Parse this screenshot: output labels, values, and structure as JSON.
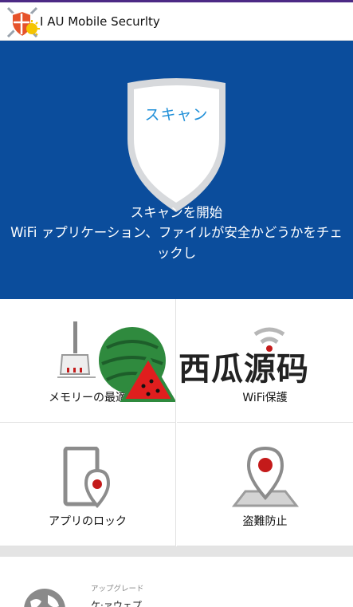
{
  "app": {
    "title": "I AU Mobile Securlty"
  },
  "hero": {
    "scan_button_label": "スキャン",
    "line1": "スキャンを開始",
    "line2": "WiFi ァプリケーション、ファイルが安全かどうかをチェックし"
  },
  "tiles": [
    {
      "label": "メモリーの最適",
      "icon": "broom-icon"
    },
    {
      "label": "WiFi保護",
      "icon": "wifi-icon"
    },
    {
      "label": "アプリのロック",
      "icon": "phone-lock-icon"
    },
    {
      "label": "盗難防止",
      "icon": "location-pin-icon"
    }
  ],
  "upgrade_card": {
    "caption": "アップグレード",
    "title": "ケ·ァウェプ"
  },
  "watermark": {
    "text": "西瓜源码"
  },
  "colors": {
    "hero_bg": "#0b4d9c",
    "accent_red": "#c41a1a",
    "scan_text": "#1f8fd8"
  }
}
